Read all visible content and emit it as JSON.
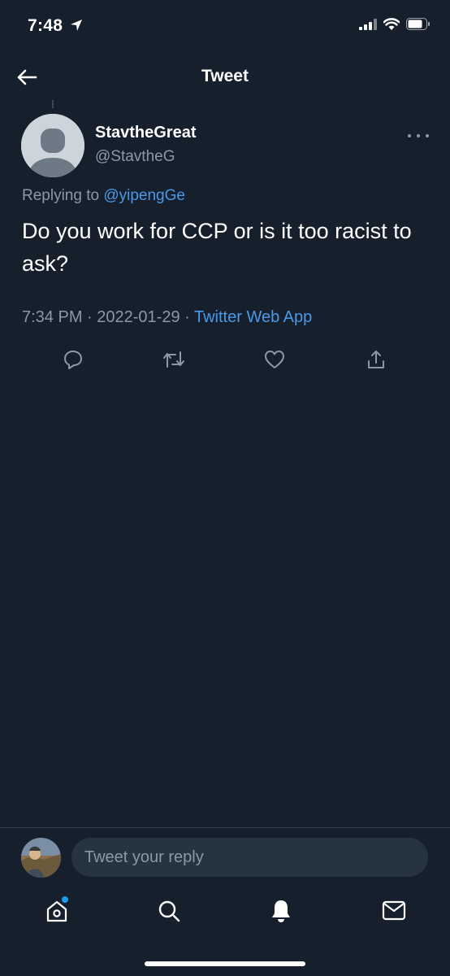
{
  "status_bar": {
    "time": "7:48"
  },
  "header": {
    "title": "Tweet"
  },
  "tweet": {
    "display_name": "StavtheGreat",
    "username": "@StavtheG",
    "replying_prefix": "Replying to ",
    "replying_to": "@yipengGe",
    "text": "Do you work for CCP or is it too racist to ask?",
    "time": "7:34 PM",
    "separator": " · ",
    "date": "2022-01-29",
    "source": "Twitter Web App"
  },
  "composer": {
    "placeholder": "Tweet your reply"
  },
  "colors": {
    "background": "#16202c",
    "accent": "#4a99e9",
    "secondary_text": "#8b98a5"
  }
}
